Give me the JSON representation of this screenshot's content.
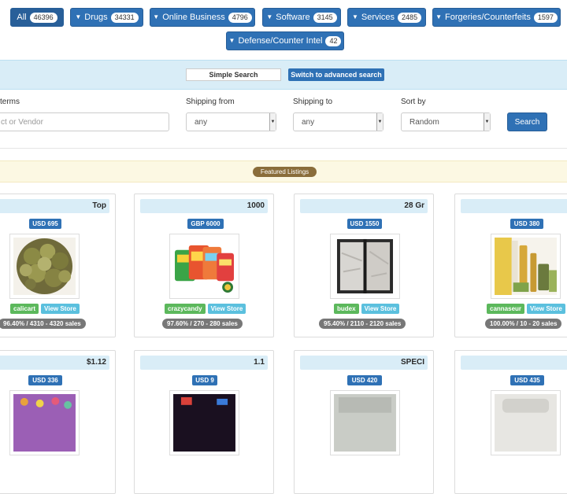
{
  "categories": [
    {
      "label": "All",
      "count": "46396",
      "dropdown": false
    },
    {
      "label": "Drugs",
      "count": "34331",
      "dropdown": true
    },
    {
      "label": "Online Business",
      "count": "4796",
      "dropdown": true
    },
    {
      "label": "Software",
      "count": "3145",
      "dropdown": true
    },
    {
      "label": "Services",
      "count": "2485",
      "dropdown": true
    },
    {
      "label": "Forgeries/Counterfeits",
      "count": "1597",
      "dropdown": true
    },
    {
      "label": "Defense/Counter Intel",
      "count": "42",
      "dropdown": true
    }
  ],
  "search": {
    "simple_tab": "Simple Search",
    "advanced_tab": "Switch to advanced search",
    "terms_label": "terms",
    "terms_placeholder": "ct or Vendor",
    "shipping_from_label": "Shipping from",
    "shipping_from_value": "any",
    "shipping_to_label": "Shipping to",
    "shipping_to_value": "any",
    "sort_label": "Sort by",
    "sort_value": "Random",
    "button": "Search"
  },
  "featured": {
    "label": "Featured Listings"
  },
  "listings_row1": [
    {
      "title": "Top",
      "price": "USD 695",
      "vendor": "calicart",
      "store": "View Store",
      "stats": "96.40% / 4310 - 4320 sales",
      "image": "cannabis-buds-image"
    },
    {
      "title": "1000",
      "price": "GBP 6000",
      "vendor": "crazycandy",
      "store": "View Store",
      "stats": "97.60% / 270 - 280 sales",
      "image": "candy-packs-image"
    },
    {
      "title": "28 Gr",
      "price": "USD 1550",
      "vendor": "budex",
      "store": "View Store",
      "stats": "95.40% / 2110 - 2120 sales",
      "image": "powder-bag-image"
    },
    {
      "title": "",
      "price": "USD 380",
      "vendor": "cannaseur",
      "store": "View Store",
      "stats": "100.00% / 10 - 20 sales",
      "image": "vape-cartridges-image"
    }
  ],
  "listings_row2": [
    {
      "title": "$1.12",
      "price": "USD 336"
    },
    {
      "title": "1.1",
      "price": "USD 9"
    },
    {
      "title": "SPECI",
      "price": "USD 420"
    },
    {
      "title": "",
      "price": "USD 435"
    }
  ],
  "colors": {
    "primary": "#2f71b5",
    "info_strip": "#d9edf7",
    "featured_strip": "#fcf8e3",
    "vendor_green": "#5cb85c",
    "store_cyan": "#5bc0de",
    "stats_gray": "#777777"
  }
}
